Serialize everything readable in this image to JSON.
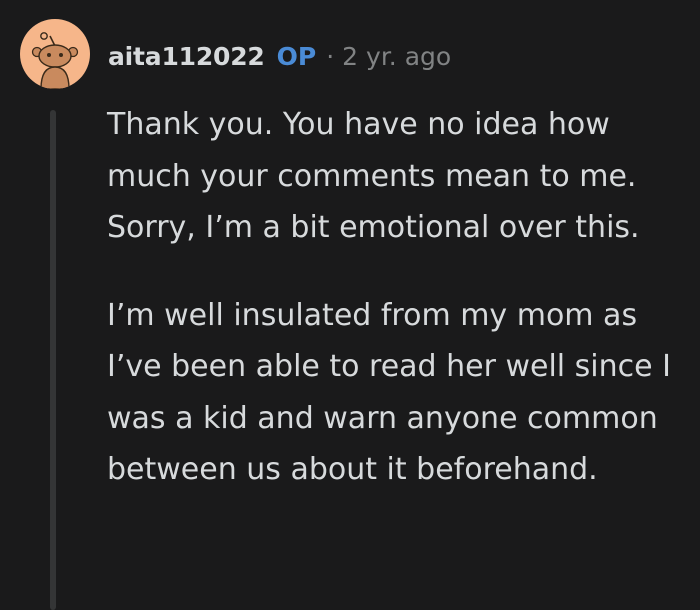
{
  "comment": {
    "author": "aita112022",
    "op_badge": "OP",
    "separator": "·",
    "timestamp": "2 yr. ago",
    "avatar_icon": "snoo-avatar-icon",
    "avatar_bg": "#f6b68a",
    "paragraphs": [
      "Thank you. You have no idea how much your comments mean to me. Sorry, I’m a bit emotional over this.",
      "I’m well insulated from my mom as I’ve been able to read her well since I was a kid and warn anyone common between us about it beforehand."
    ]
  },
  "colors": {
    "background": "#1a1a1b",
    "text": "#d7dadc",
    "op_accent": "#4a8bd6",
    "muted": "#818384",
    "thread_line": "#343536"
  }
}
